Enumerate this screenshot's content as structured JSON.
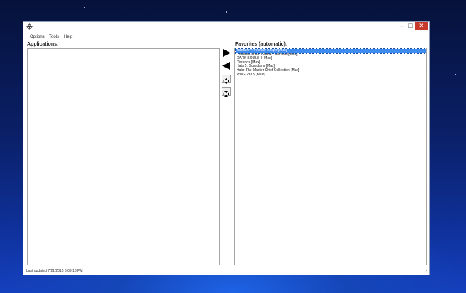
{
  "window": {
    "title": "",
    "controls": {
      "minimize": "–",
      "maximize": "□",
      "close": "✕"
    }
  },
  "menu": [
    "Options",
    "Tools",
    "Help"
  ],
  "applications": {
    "label": "Applications:",
    "items": []
  },
  "favorites": {
    "label": "Favorites (automatic):",
    "selected_index": 0,
    "items": [
      "Batman™: Arkham Knight [Max]",
      "Counter-Strike: Global Offensive [Max]",
      "DARK SOULS II [Max]",
      "Distance [Max]",
      "Halo 5: Guardians [Max]",
      "Halo: The Master Chief Collection [Max]",
      "WWE 2K15 [Max]"
    ]
  },
  "controls": {
    "add_icon": "play-right-icon",
    "remove_icon": "play-left-icon",
    "move_up_icon": "move-up-icon",
    "move_down_icon": "move-down-icon"
  },
  "status": {
    "text": "Last updated 7/21/2015 6:09:16 PM"
  },
  "colors": {
    "selection": "#3f8cf0",
    "close_button": "#c7392b"
  }
}
